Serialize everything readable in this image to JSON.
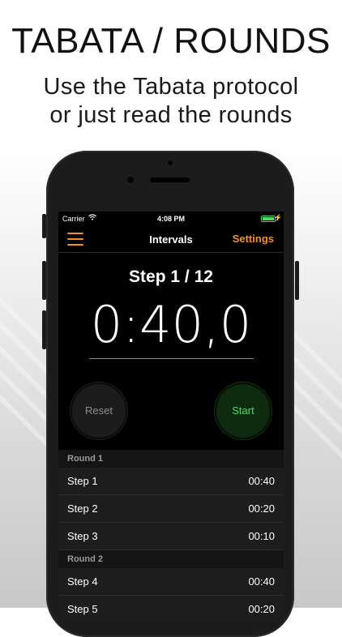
{
  "marketing": {
    "headline": "TABATA / ROUNDS",
    "subline_1": "Use the Tabata protocol",
    "subline_2": "or just read the rounds"
  },
  "status_bar": {
    "carrier": "Carrier",
    "time": "4:08 PM",
    "battery_level": 1.0,
    "charging": true
  },
  "nav": {
    "menu_icon": "hamburger-icon",
    "title": "Intervals",
    "settings_label": "Settings"
  },
  "timer": {
    "step_label": "Step 1 / 12",
    "display": "0:40,0"
  },
  "controls": {
    "reset_label": "Reset",
    "start_label": "Start"
  },
  "rounds": [
    {
      "header": "Round 1",
      "steps": [
        {
          "name": "Step 1",
          "duration": "00:40"
        },
        {
          "name": "Step 2",
          "duration": "00:20"
        },
        {
          "name": "Step 3",
          "duration": "00:10"
        }
      ]
    },
    {
      "header": "Round 2",
      "steps": [
        {
          "name": "Step 4",
          "duration": "00:40"
        },
        {
          "name": "Step 5",
          "duration": "00:20"
        }
      ]
    }
  ],
  "colors": {
    "accent": "#f0902a",
    "start_green": "#4cd964",
    "screen_background": "#000000",
    "row_background": "#1d1d1d"
  }
}
